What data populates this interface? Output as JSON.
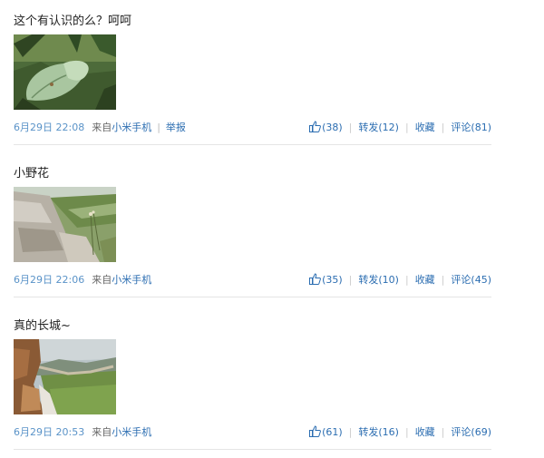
{
  "posts": [
    {
      "text": "这个有认识的么？呵呵",
      "time": "6月29日 22:08",
      "from_label": "来自",
      "app": "小米手机",
      "separator": "|",
      "report": "举报",
      "like_count": "(38)",
      "repost": "转发(12)",
      "favorite": "收藏",
      "comment": "评论(81)",
      "image_icon": "luna-moth-photo"
    },
    {
      "text": "小野花",
      "time": "6月29日 22:06",
      "from_label": "来自",
      "app": "小米手机",
      "like_count": "(35)",
      "repost": "转发(10)",
      "favorite": "收藏",
      "comment": "评论(45)",
      "image_icon": "wildflower-on-wall-photo"
    },
    {
      "text": "真的长城~",
      "time": "6月29日 20:53",
      "from_label": "来自",
      "app": "小米手机",
      "like_count": "(61)",
      "repost": "转发(16)",
      "favorite": "收藏",
      "comment": "评论(69)",
      "image_icon": "great-wall-photo"
    }
  ],
  "action_separator": "|",
  "colors": {
    "link": "#2b6db1",
    "time": "#5a93c8",
    "divider": "#e5e5e5"
  }
}
